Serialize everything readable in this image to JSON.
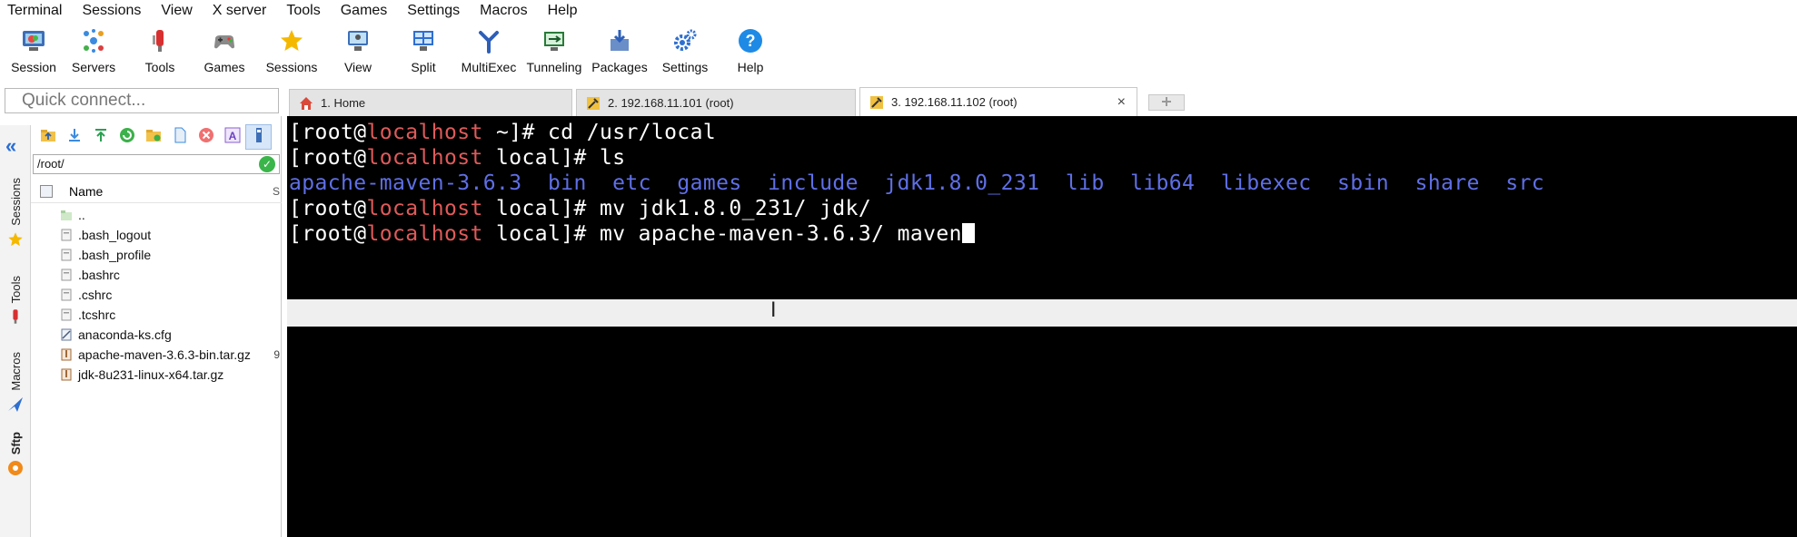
{
  "menu": [
    "Terminal",
    "Sessions",
    "View",
    "X server",
    "Tools",
    "Games",
    "Settings",
    "Macros",
    "Help"
  ],
  "toolbar": [
    {
      "label": "Session",
      "icon": "session-icon"
    },
    {
      "label": "Servers",
      "icon": "servers-icon"
    },
    {
      "label": "Tools",
      "icon": "tools-icon"
    },
    {
      "label": "Games",
      "icon": "games-icon"
    },
    {
      "label": "Sessions",
      "icon": "star-icon"
    },
    {
      "label": "View",
      "icon": "view-icon"
    },
    {
      "label": "Split",
      "icon": "split-icon"
    },
    {
      "label": "MultiExec",
      "icon": "multiexec-icon"
    },
    {
      "label": "Tunneling",
      "icon": "tunneling-icon"
    },
    {
      "label": "Packages",
      "icon": "packages-icon"
    },
    {
      "label": "Settings",
      "icon": "gear-icon"
    },
    {
      "label": "Help",
      "icon": "help-icon"
    }
  ],
  "quick_connect": {
    "placeholder": "Quick connect..."
  },
  "tabs": [
    {
      "label": "1. Home",
      "icon": "home-icon"
    },
    {
      "label": "2. 192.168.11.101 (root)",
      "icon": "ssh-icon"
    },
    {
      "label": "3. 192.168.11.102 (root)",
      "icon": "ssh-icon",
      "close": "×"
    }
  ],
  "sidetabs": [
    "Sessions",
    "Tools",
    "Macros",
    "Sftp"
  ],
  "sftp": {
    "path": "/root/",
    "column_name": "Name",
    "column_size": "S",
    "files": [
      {
        "name": "..",
        "type": "up",
        "size": ""
      },
      {
        "name": ".bash_logout",
        "type": "file",
        "size": ""
      },
      {
        "name": ".bash_profile",
        "type": "file",
        "size": ""
      },
      {
        "name": ".bashrc",
        "type": "file",
        "size": ""
      },
      {
        "name": ".cshrc",
        "type": "file",
        "size": ""
      },
      {
        "name": ".tcshrc",
        "type": "file",
        "size": ""
      },
      {
        "name": "anaconda-ks.cfg",
        "type": "cfg",
        "size": ""
      },
      {
        "name": "apache-maven-3.6.3-bin.tar.gz",
        "type": "archive",
        "size": "9"
      },
      {
        "name": "jdk-8u231-linux-x64.tar.gz",
        "type": "archive",
        "size": ""
      }
    ]
  },
  "terminal": {
    "lines": [
      {
        "user": "[root@",
        "host": "localhost",
        "rest": " ~]# cd /usr/local"
      },
      {
        "user": "[root@",
        "host": "localhost",
        "rest": " local]# ls"
      },
      {
        "dirs": "apache-maven-3.6.3  bin  etc  games  include  jdk1.8.0_231  lib  lib64  libexec  sbin  share  src"
      },
      {
        "user": "[root@",
        "host": "localhost",
        "rest": " local]# mv jdk1.8.0_231/ jdk/"
      },
      {
        "user": "[root@",
        "host": "localhost",
        "rest": " local]# mv apache-maven-3.6.3/ maven"
      }
    ]
  },
  "colors": {
    "host": "#e05a5a",
    "dir": "#5f6fe6",
    "accent": "#2a6fd6"
  }
}
